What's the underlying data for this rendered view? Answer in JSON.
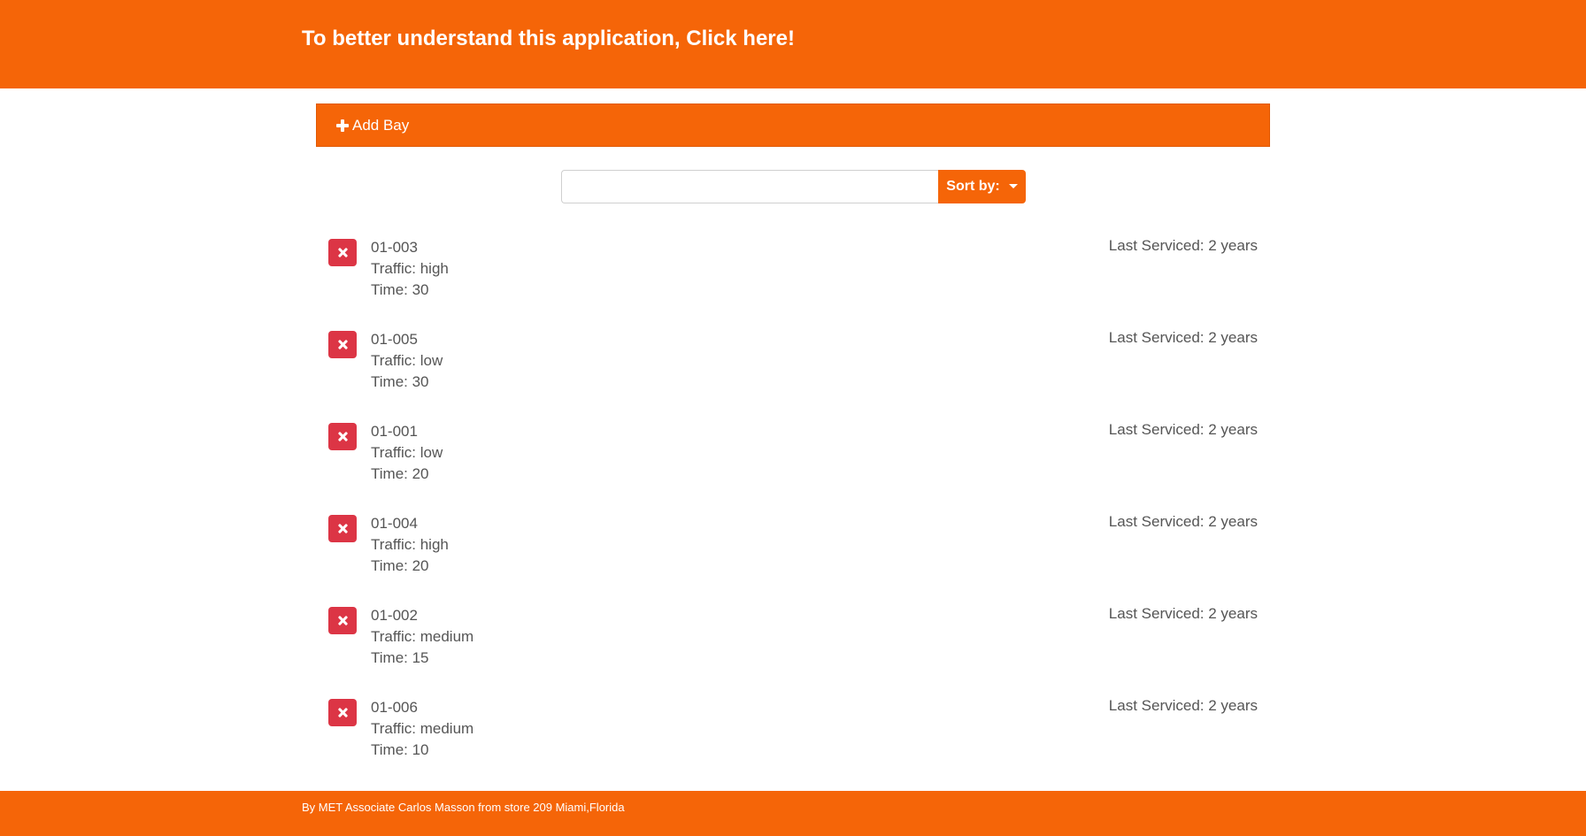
{
  "header": {
    "link_text": "To better understand this application, Click here!"
  },
  "toolbar": {
    "add_bay_label": "Add Bay",
    "add_bay_icon": "plus-icon"
  },
  "search": {
    "value": "",
    "placeholder": "",
    "sort_label": "Sort by:"
  },
  "bays": [
    {
      "id": "01-003",
      "traffic": "Traffic: high",
      "time": "Time: 30",
      "last_serviced": "Last Serviced: 2 years"
    },
    {
      "id": "01-005",
      "traffic": "Traffic: low",
      "time": "Time: 30",
      "last_serviced": "Last Serviced: 2 years"
    },
    {
      "id": "01-001",
      "traffic": "Traffic: low",
      "time": "Time: 20",
      "last_serviced": "Last Serviced: 2 years"
    },
    {
      "id": "01-004",
      "traffic": "Traffic: high",
      "time": "Time: 20",
      "last_serviced": "Last Serviced: 2 years"
    },
    {
      "id": "01-002",
      "traffic": "Traffic: medium",
      "time": "Time: 15",
      "last_serviced": "Last Serviced: 2 years"
    },
    {
      "id": "01-006",
      "traffic": "Traffic: medium",
      "time": "Time: 10",
      "last_serviced": "Last Serviced: 2 years"
    }
  ],
  "footer": {
    "text": "By MET Associate Carlos Masson from store 209 Miami,Florida"
  },
  "colors": {
    "brand_orange": "#f56508",
    "delete_red": "#dc3545",
    "text_gray": "#555555"
  }
}
